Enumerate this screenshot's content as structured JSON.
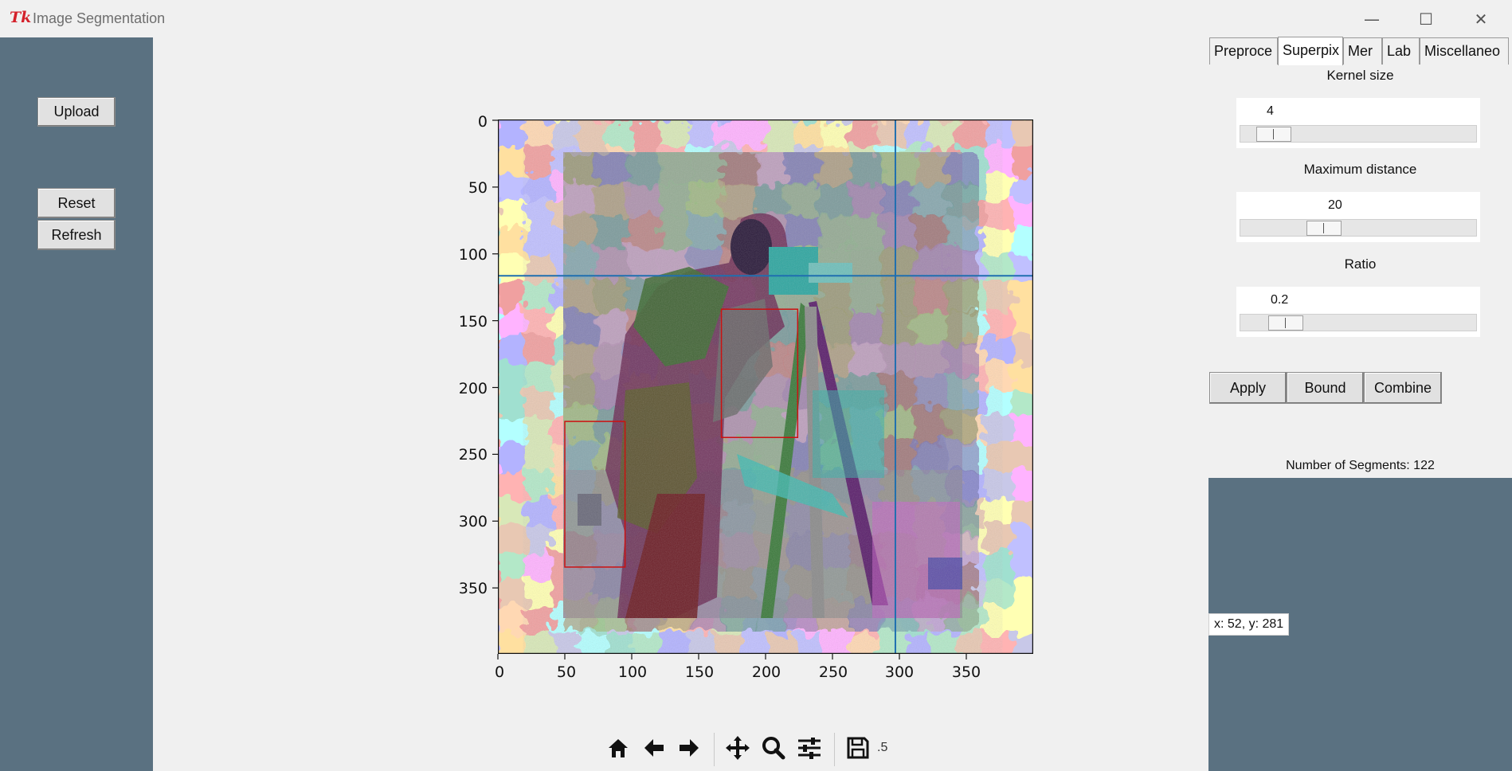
{
  "window": {
    "title": "Image Segmentation",
    "minimize_glyph": "—",
    "maximize_glyph": "☐",
    "close_glyph": "✕",
    "app_icon": "tk-feather-icon"
  },
  "left_panel": {
    "upload_label": "Upload",
    "reset_label": "Reset",
    "refresh_label": "Refresh"
  },
  "plot": {
    "y_ticks": [
      "0",
      "50",
      "100",
      "150",
      "200",
      "250",
      "300",
      "350"
    ],
    "x_ticks": [
      "0",
      "50",
      "100",
      "150",
      "200",
      "250",
      "300",
      "350"
    ],
    "crosshair": {
      "x": 297,
      "y": 117
    },
    "boxes": [
      {
        "x0": 167,
        "y0": 142,
        "x1": 224,
        "y1": 238
      },
      {
        "x0": 50,
        "y0": 226,
        "x1": 95,
        "y1": 335
      }
    ],
    "image_extent": {
      "x0": 50,
      "y0": 25,
      "x1": 380,
      "y1": 356
    },
    "colors": {
      "crosshair": "#1f6fb0",
      "box": "#cc1111"
    }
  },
  "tabs": {
    "items": [
      "Preproce",
      "Superpix",
      "Mer",
      "Lab",
      "Miscellaneo"
    ],
    "active": "Superpix"
  },
  "params": {
    "kernel_label": "Kernel size",
    "kernel_value": "4",
    "kernel_fraction": 0.08,
    "maxdist_label": "Maximum distance",
    "maxdist_value": "20",
    "maxdist_fraction": 0.33,
    "ratio_label": "Ratio",
    "ratio_value": "0.2",
    "ratio_fraction": 0.14
  },
  "actions": {
    "apply_label": "Apply",
    "bound_label": "Bound",
    "combine_label": "Combine"
  },
  "status": {
    "segments_text": "Number of Segments: 122",
    "coords_text": "x: 52, y: 281"
  },
  "toolbar": {
    "items": [
      "home-icon",
      "back-icon",
      "forward-icon",
      "pan-icon",
      "zoom-icon",
      "configure-icon",
      "save-icon"
    ],
    "trailing_text": ".5"
  },
  "theme": {
    "panel_bg": "#5a7181",
    "window_bg": "#f0f0f0"
  }
}
